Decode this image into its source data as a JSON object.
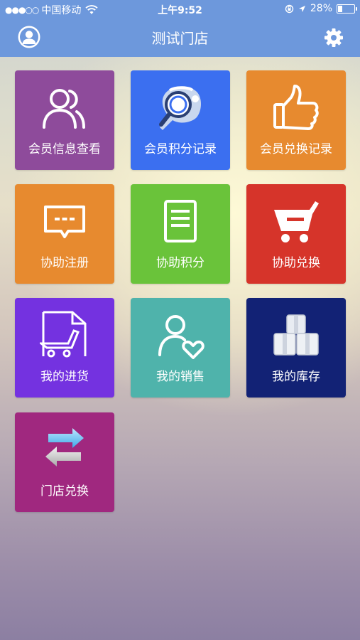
{
  "status_bar": {
    "carrier": "中国移动",
    "time": "上午9:52",
    "battery": "28%",
    "battery_level": 0.28
  },
  "nav": {
    "title": "测试门店",
    "left_icon": "user-avatar-icon",
    "right_icon": "gear-icon"
  },
  "colors": {
    "nav_bar": "#6d98dc",
    "purple": "#8e4b9b",
    "blue": "#3b6ff0",
    "orange": "#e78a2f",
    "green": "#6ac33a",
    "red": "#d6342a",
    "violet": "#7432e0",
    "teal": "#4fb3ab",
    "navy": "#122275",
    "magenta": "#a0287f"
  },
  "tiles": [
    {
      "label": "会员信息查看",
      "icon": "users-icon",
      "color": "#8e4b9b"
    },
    {
      "label": "会员积分记录",
      "icon": "search-points-icon",
      "color": "#3b6ff0"
    },
    {
      "label": "会员兑换记录",
      "icon": "thumbs-up-icon",
      "color": "#e78a2f"
    },
    {
      "label": "协助注册",
      "icon": "chat-bubble-icon",
      "color": "#e78a2f"
    },
    {
      "label": "协助积分",
      "icon": "document-icon",
      "color": "#6ac33a"
    },
    {
      "label": "协助兑换",
      "icon": "shopping-cart-icon",
      "color": "#d6342a"
    },
    {
      "label": "我的进货",
      "icon": "cart-invoice-icon",
      "color": "#7432e0"
    },
    {
      "label": "我的销售",
      "icon": "user-heart-icon",
      "color": "#4fb3ab"
    },
    {
      "label": "我的库存",
      "icon": "boxes-icon",
      "color": "#122275"
    },
    {
      "label": "门店兑换",
      "icon": "exchange-arrows-icon",
      "color": "#a0287f"
    }
  ]
}
